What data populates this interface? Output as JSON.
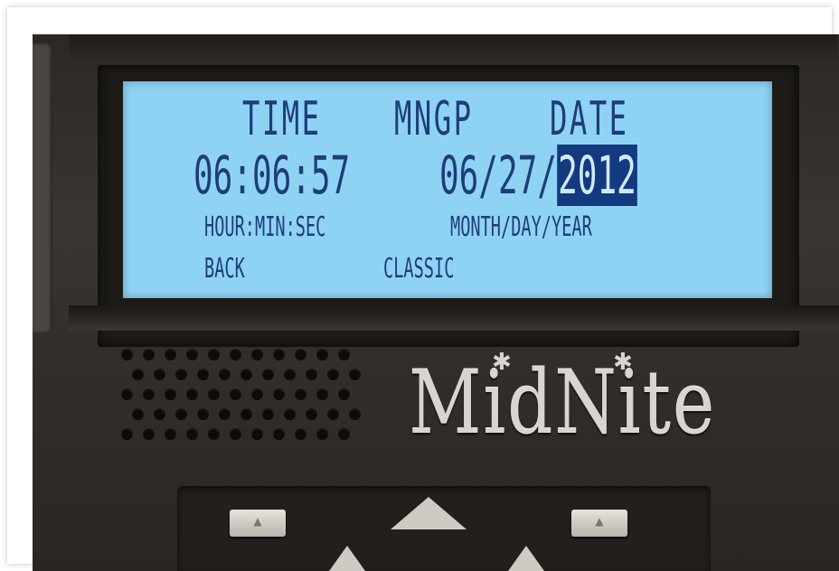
{
  "lcd": {
    "header_time": "TIME",
    "header_mode": "MNGP",
    "header_date": "DATE",
    "time_value": "06:06:57",
    "date_prefix": "06/27/",
    "date_year": "2012",
    "time_format": "HOUR:MIN:SEC",
    "date_format": "MONTH/DAY/YEAR",
    "softkey_left": "BACK",
    "softkey_center": "CLASSIC"
  },
  "brand": {
    "logo_text": "MidNite"
  },
  "colors": {
    "lcd_background": "#8fd3f4",
    "lcd_text": "#1e3d7a",
    "highlight": "#13397f",
    "body": "#332e29"
  },
  "icons": [
    "speaker-grille-icon",
    "up-arrow-icon",
    "left-arrow-icon",
    "right-arrow-icon"
  ]
}
